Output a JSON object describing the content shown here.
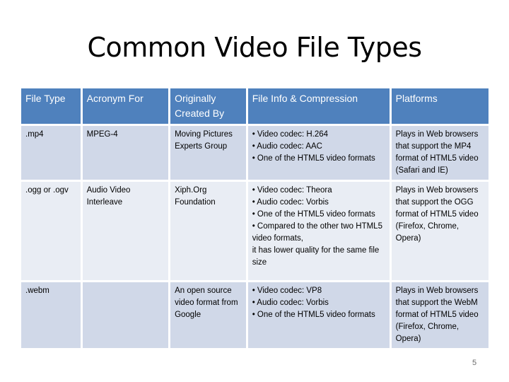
{
  "slide": {
    "title": "Common Video File Types",
    "page_number": "5"
  },
  "colors": {
    "header_bg": "#4f81bd",
    "row_odd_bg": "#d0d8e8",
    "row_even_bg": "#e9edf4"
  },
  "table": {
    "headers": [
      "File Type",
      "Acronym For",
      "Originally Created By",
      "File Info & Compression",
      "Platforms"
    ],
    "rows": [
      {
        "file_type": ".mp4",
        "acronym_for": "MPEG-4",
        "created_by": "Moving Pictures Experts Group",
        "info": [
          "• Video codec: H.264",
          "• Audio codec: AAC",
          "• One of the HTML5 video formats"
        ],
        "platforms": "Plays in Web browsers that support the MP4 format of HTML5 video (Safari and IE)"
      },
      {
        "file_type": ".ogg or .ogv",
        "acronym_for": "Audio Video Interleave",
        "created_by": "Xiph.Org Foundation",
        "info": [
          "• Video codec: Theora",
          "• Audio codec: Vorbis",
          "• One of the HTML5 video formats",
          "• Compared to the other two HTML5 video formats,",
          "it has lower quality for the same file size"
        ],
        "platforms": "Plays in Web browsers that support the OGG format of HTML5 video (Firefox, Chrome, Opera)"
      },
      {
        "file_type": ".webm",
        "acronym_for": "",
        "created_by": "An open source video format from Google",
        "info": [
          "• Video codec: VP8",
          "• Audio codec: Vorbis",
          "• One of the HTML5 video formats"
        ],
        "platforms": "Plays in Web browsers that support the WebM format of HTML5 video (Firefox, Chrome, Opera)"
      }
    ]
  }
}
